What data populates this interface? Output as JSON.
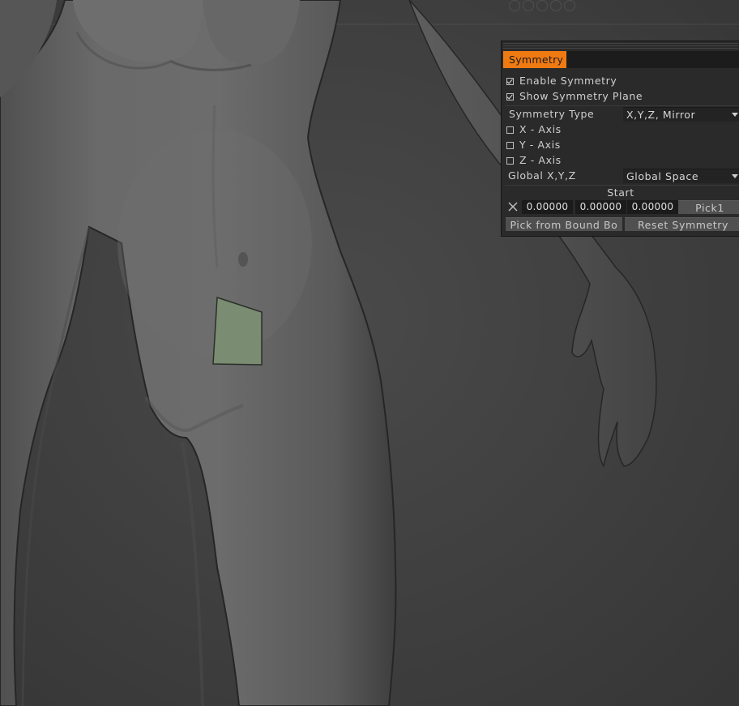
{
  "panel": {
    "title": "Symmetry",
    "enable_symmetry": {
      "label": "Enable  Symmetry",
      "checked": true
    },
    "show_plane": {
      "label": "Show  Symmetry  Plane",
      "checked": true
    },
    "symmetry_type": {
      "label": "Symmetry  Type",
      "value": "X,Y,Z,  Mirror"
    },
    "axes": [
      {
        "label": "X  -  Axis",
        "checked": false
      },
      {
        "label": "Y  -  Axis",
        "checked": false
      },
      {
        "label": "Z  -  Axis",
        "checked": false
      }
    ],
    "space": {
      "label": "Global  X,Y,Z",
      "value": "Global  Space"
    },
    "start_label": "Start",
    "start_values": [
      "0.00000",
      "0.00000",
      "0.00000"
    ],
    "pick_button": "Pick1",
    "pick_bound_button": "Pick  from  Bound  Bo",
    "reset_button": "Reset  Symmetry"
  },
  "icons": {
    "clear": "close-icon",
    "dropdown": "chevron-down-icon"
  },
  "colors": {
    "accent": "#f07a12",
    "selected_face": "#7a8c72",
    "background": "#3d3d3d"
  }
}
